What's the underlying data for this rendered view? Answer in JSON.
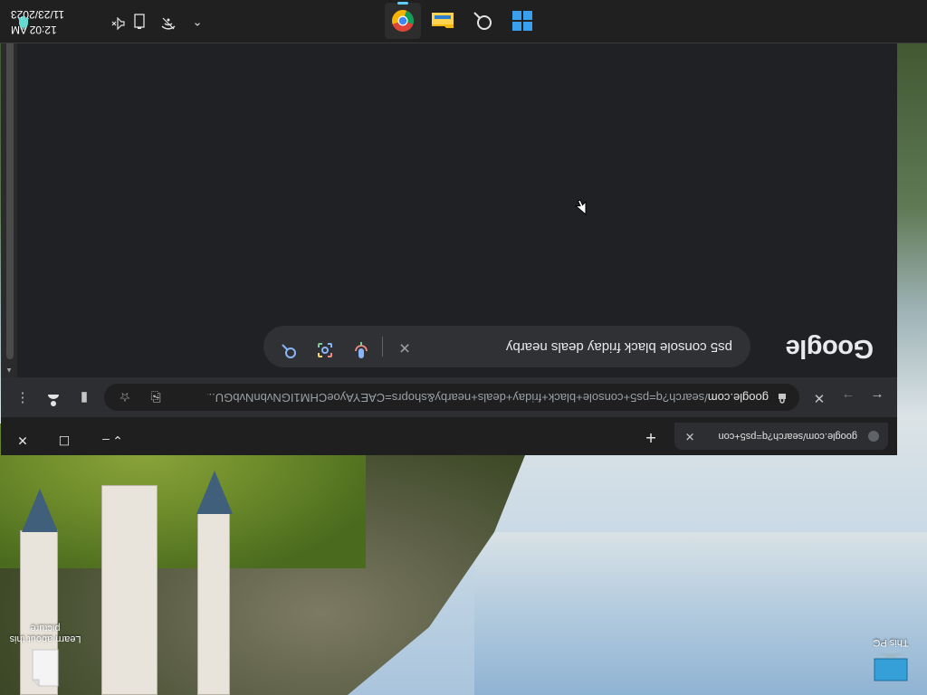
{
  "desktop": {
    "icons": [
      {
        "label": "This PC",
        "icon": "monitor-icon"
      },
      {
        "label": "Learn about this picture",
        "icon": "document-icon"
      }
    ]
  },
  "browser": {
    "tab": {
      "title": "google.com/search?q=ps5+con"
    },
    "new_tab_label": "+",
    "window_controls": {
      "minimize": "–",
      "maximize": "☐",
      "close": "✕",
      "tab_search": "⌄"
    },
    "toolbar": {
      "back": "←",
      "forward": "→",
      "stop": "✕",
      "url_host": "google.com",
      "url_rest": "/search?q=ps5+console+black+friday+deals+nearby&shoprs=CAEYAyoeCHM1IGNvbnNvbGU...",
      "menu": "⋮"
    },
    "page": {
      "logo": "Google",
      "search_query": "ps5 console black friday deals nearby",
      "clear": "✕"
    }
  },
  "taskbar": {
    "apps": [
      {
        "name": "start",
        "icon": "windows-icon"
      },
      {
        "name": "search",
        "icon": "search-icon"
      },
      {
        "name": "file-explorer",
        "icon": "folder-icon"
      },
      {
        "name": "chrome",
        "icon": "chrome-icon",
        "active": true
      }
    ],
    "tray": {
      "chevron": "⌃",
      "time": "12:02 AM",
      "date": "11/23/2023"
    }
  },
  "colors": {
    "google_blue": "#8ab4f8",
    "google_red": "#f28b82",
    "google_yellow": "#fdd663",
    "google_green": "#81c995",
    "chrome_bg": "#202124"
  }
}
